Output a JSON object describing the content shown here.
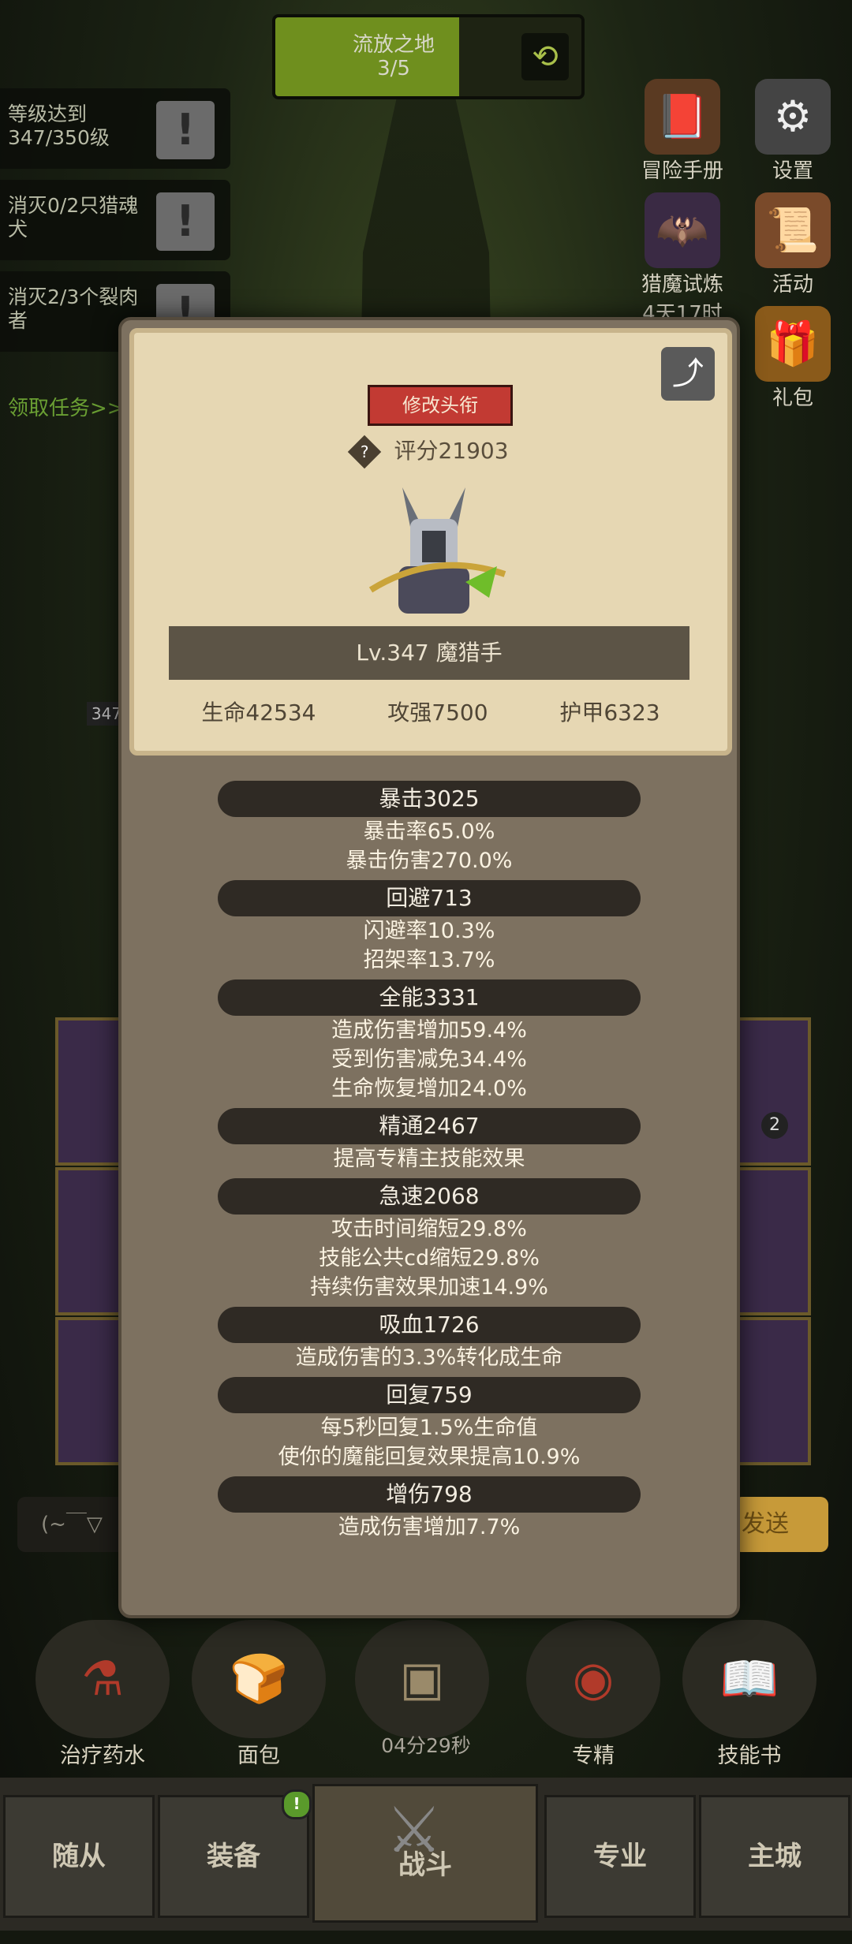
{
  "level": {
    "name": "流放之地",
    "progress": "3/5",
    "fill": 0.6
  },
  "quests": [
    {
      "text": "等级达到347/350级"
    },
    {
      "text": "消灭0/2只猎魂犬"
    },
    {
      "text": "消灭2/3个裂肉者"
    }
  ],
  "quest_link": "领取任务>>",
  "right_menu": {
    "manual": "冒险手册",
    "settings": "设置",
    "trial": "猎魔试炼",
    "trial_time": "4天17时",
    "events": "活动",
    "gift": "礼包"
  },
  "bg_level_tag": "347",
  "profile": {
    "edit_title": "修改头衔",
    "score": "评分21903",
    "name": "Lv.347 魔猎手",
    "hp": "生命42534",
    "atk": "攻强7500",
    "armor": "护甲6323"
  },
  "stats": [
    {
      "head": "暴击3025",
      "lines": [
        "暴击率65.0%",
        "暴击伤害270.0%"
      ]
    },
    {
      "head": "回避713",
      "lines": [
        "闪避率10.3%",
        "招架率13.7%"
      ]
    },
    {
      "head": "全能3331",
      "lines": [
        "造成伤害增加59.4%",
        "受到伤害减免34.4%",
        "生命恢复增加24.0%"
      ]
    },
    {
      "head": "精通2467",
      "lines": [
        "提高专精主技能效果"
      ]
    },
    {
      "head": "急速2068",
      "lines": [
        "攻击时间缩短29.8%",
        "技能公共cd缩短29.8%",
        "持续伤害效果加速14.9%"
      ]
    },
    {
      "head": "吸血1726",
      "lines": [
        "造成伤害的3.3%转化成生命"
      ]
    },
    {
      "head": "回复759",
      "lines": [
        "每5秒回复1.5%生命值",
        "使你的魔能回复效果提高10.9%"
      ]
    },
    {
      "head": "增伤798",
      "lines": [
        "造成伤害增加7.7%"
      ]
    }
  ],
  "chat": {
    "placeholder": "(~￣▽",
    "send": "发送"
  },
  "items": {
    "potion": "治疗药水",
    "bread": "面包",
    "timer": "04分29秒",
    "spec": "专精",
    "skillbook": "技能书"
  },
  "item_badge": "2",
  "nav": {
    "followers": "随从",
    "equipment": "装备",
    "battle": "战斗",
    "profession": "专业",
    "city": "主城",
    "equip_badge": "!"
  },
  "colors": {
    "accent_red": "#c23a33",
    "panel_bg": "#7d7160",
    "card_bg": "#e6d7b3"
  }
}
